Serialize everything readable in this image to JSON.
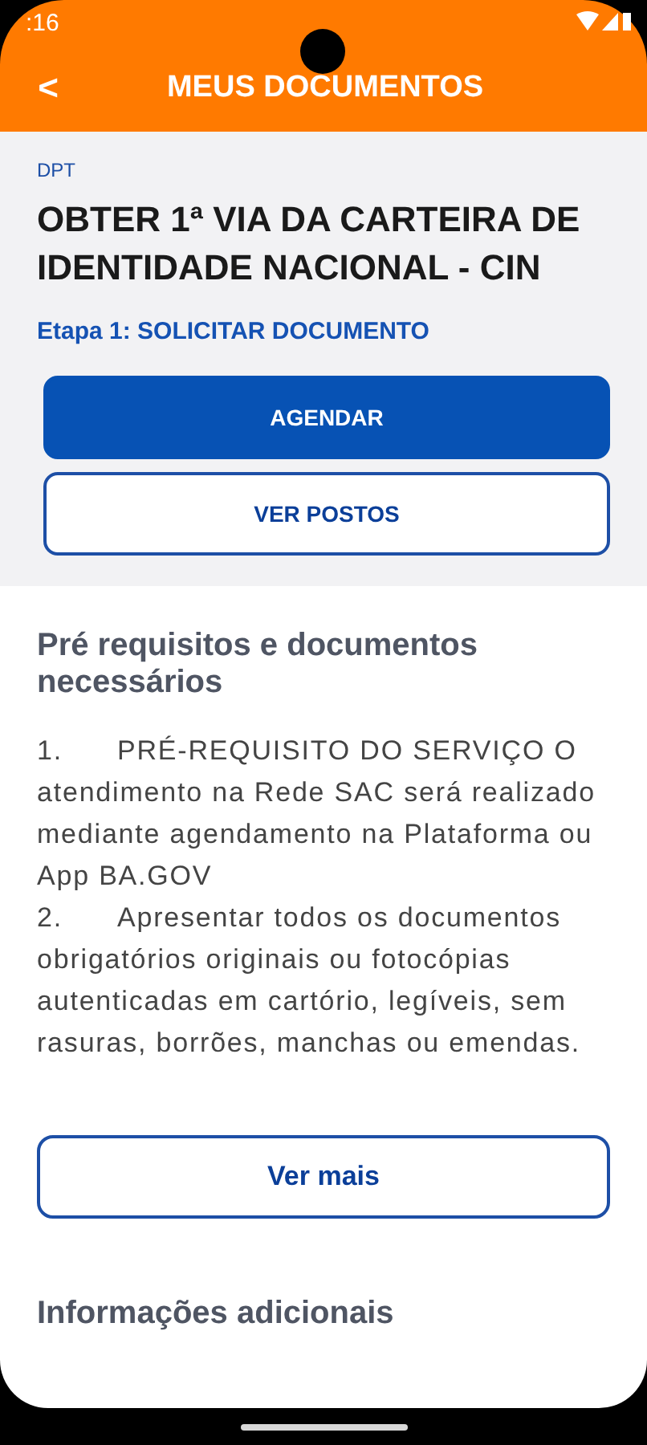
{
  "status_bar": {
    "time": ":16"
  },
  "header": {
    "back": "<",
    "title": "MEUS DOCUMENTOS"
  },
  "service": {
    "agency": "DPT",
    "title": "OBTER 1ª VIA DA CARTEIRA DE IDENTIDADE NACIONAL - CIN",
    "step": "Etapa 1: SOLICITAR DOCUMENTO"
  },
  "buttons": [
    {
      "label": "AGENDAR",
      "kind": "filled"
    },
    {
      "label": "VER POSTOS",
      "kind": "outline"
    }
  ],
  "requirements": {
    "heading": "Pré requisitos e documentos necessários",
    "items": [
      {
        "number": "1.",
        "text": "PRÉ-REQUISITO DO SERVIÇO O atendimento na Rede SAC será realizado mediante agendamento na Plataforma ou App BA.GOV"
      },
      {
        "number": "2.",
        "text": "Apresentar todos os documentos obrigatórios originais ou fotocópias autenticadas em cartório, legíveis, sem rasuras, borrões, manchas ou emendas."
      }
    ],
    "more": "Ver mais"
  },
  "additional": {
    "heading": "Informações adicionais"
  }
}
